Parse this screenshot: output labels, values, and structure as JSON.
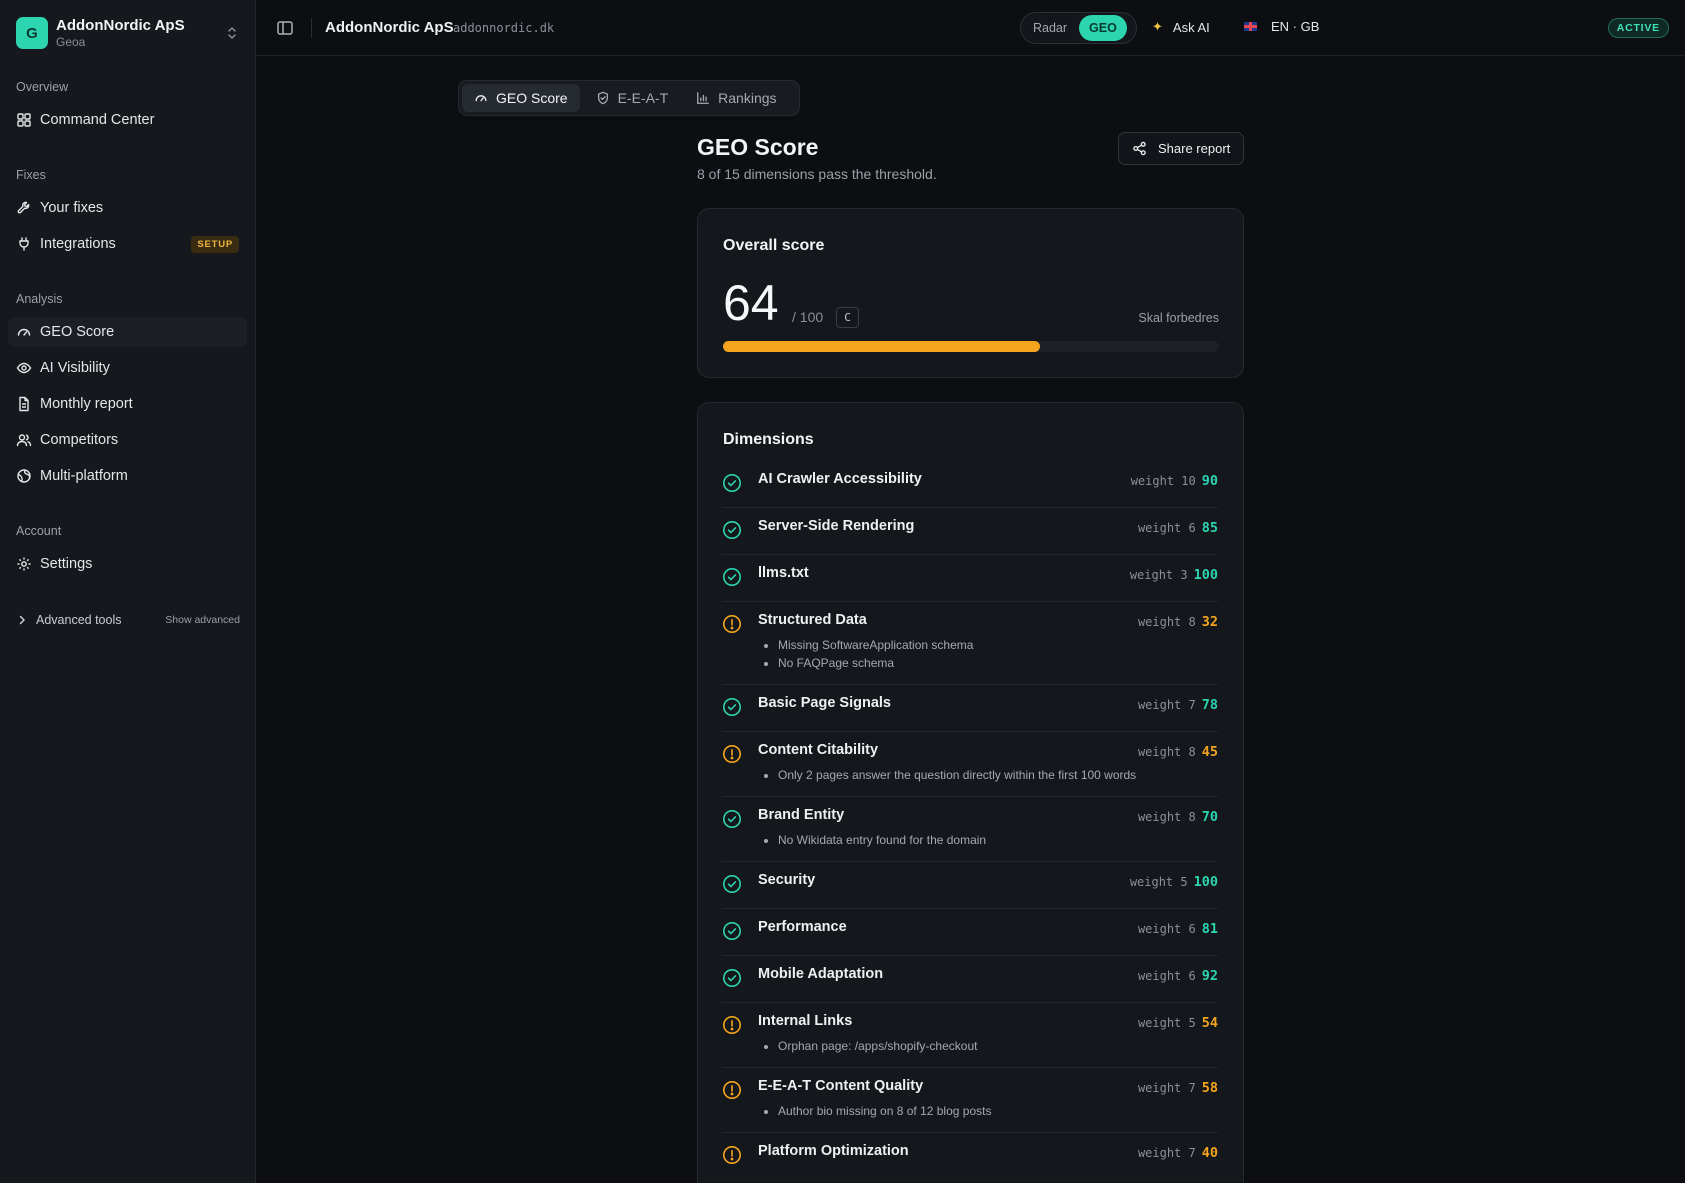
{
  "org": {
    "initial": "G",
    "name": "AddonNordic ApS",
    "product": "Geoa"
  },
  "sidebar": {
    "sections": [
      {
        "title": "Overview"
      },
      {
        "title": "Fixes"
      },
      {
        "title": "Analysis"
      },
      {
        "title": "Account"
      }
    ],
    "items": [
      {
        "label": "Command Center",
        "icon": "grid-icon"
      },
      {
        "label": "Your fixes",
        "icon": "wrench-icon"
      },
      {
        "label": "Integrations",
        "icon": "plug-icon",
        "badge": "SETUP"
      },
      {
        "label": "GEO Score",
        "icon": "gauge-icon",
        "active": true
      },
      {
        "label": "AI Visibility",
        "icon": "eye-icon"
      },
      {
        "label": "Monthly report",
        "icon": "file-icon"
      },
      {
        "label": "Competitors",
        "icon": "users-icon"
      },
      {
        "label": "Multi-platform",
        "icon": "globe-icon"
      },
      {
        "label": "Settings",
        "icon": "gear-icon"
      }
    ],
    "advanced": {
      "label": "Advanced tools",
      "toggle": "Show advanced"
    }
  },
  "topbar": {
    "title": "AddonNordic ApS",
    "domain": "addonnordic.dk",
    "mode": {
      "options": [
        "Radar",
        "GEO"
      ],
      "selected": "GEO"
    },
    "ask_ai": "Ask AI",
    "language": "EN · GB",
    "status": "ACTIVE"
  },
  "tabs": [
    {
      "label": "GEO Score",
      "icon": "gauge-icon",
      "active": true
    },
    {
      "label": "E-E-A-T",
      "icon": "shield-check-icon"
    },
    {
      "label": "Rankings",
      "icon": "bar-chart-icon"
    }
  ],
  "header": {
    "title": "GEO Score",
    "subtitle": "8 of 15 dimensions pass the threshold.",
    "share_label": "Share report"
  },
  "overall": {
    "title": "Overall score",
    "score": 64,
    "max": "/ 100",
    "grade": "C",
    "label": "Skal forbedres",
    "progress_fraction": 0.64
  },
  "dimensions": {
    "title": "Dimensions",
    "items": [
      {
        "name": "AI Crawler Accessibility",
        "weight": "weight 10",
        "score": "90",
        "status": "pass",
        "notes": []
      },
      {
        "name": "Server-Side Rendering",
        "weight": "weight 6",
        "score": "85",
        "status": "pass",
        "notes": []
      },
      {
        "name": "llms.txt",
        "weight": "weight 3",
        "score": "100",
        "status": "pass",
        "notes": []
      },
      {
        "name": "Structured Data",
        "weight": "weight 8",
        "score": "32",
        "status": "warn",
        "notes": [
          "Missing SoftwareApplication schema",
          "No FAQPage schema"
        ]
      },
      {
        "name": "Basic Page Signals",
        "weight": "weight 7",
        "score": "78",
        "status": "pass",
        "notes": []
      },
      {
        "name": "Content Citability",
        "weight": "weight 8",
        "score": "45",
        "status": "warn",
        "notes": [
          "Only 2 pages answer the question directly within the first 100 words"
        ]
      },
      {
        "name": "Brand Entity",
        "weight": "weight 8",
        "score": "70",
        "status": "pass",
        "notes": [
          "No Wikidata entry found for the domain"
        ]
      },
      {
        "name": "Security",
        "weight": "weight 5",
        "score": "100",
        "status": "pass",
        "notes": []
      },
      {
        "name": "Performance",
        "weight": "weight 6",
        "score": "81",
        "status": "pass",
        "notes": []
      },
      {
        "name": "Mobile Adaptation",
        "weight": "weight 6",
        "score": "92",
        "status": "pass",
        "notes": []
      },
      {
        "name": "Internal Links",
        "weight": "weight 5",
        "score": "54",
        "status": "warn",
        "notes": [
          "Orphan page: /apps/shopify-checkout"
        ]
      },
      {
        "name": "E-E-A-T Content Quality",
        "weight": "weight 7",
        "score": "58",
        "status": "warn",
        "notes": [
          "Author bio missing on 8 of 12 blog posts"
        ]
      },
      {
        "name": "Platform Optimization",
        "weight": "weight 7",
        "score": "40",
        "status": "warn",
        "notes": []
      }
    ]
  },
  "colors": {
    "accent": "#2dd4b0",
    "warning": "#f3a51e",
    "background": "#0c0e11"
  }
}
